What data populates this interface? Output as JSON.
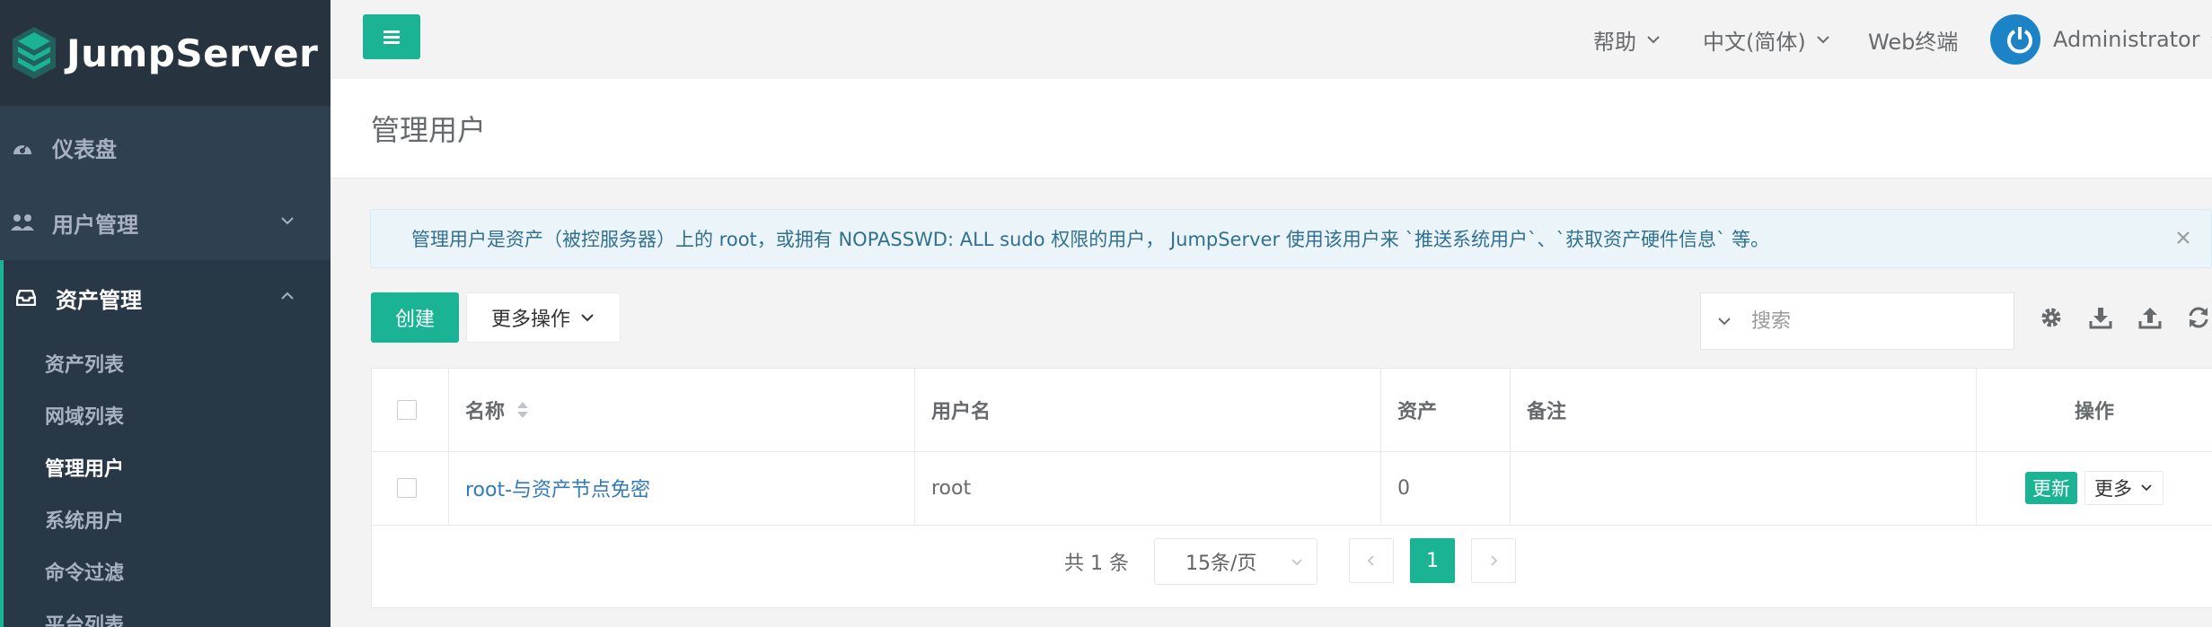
{
  "brand": {
    "name": "JumpServer"
  },
  "sidebar": {
    "items": [
      {
        "label": "仪表盘",
        "icon": "dashboard-icon"
      },
      {
        "label": "用户管理",
        "icon": "users-icon"
      },
      {
        "label": "资产管理",
        "icon": "inbox-icon"
      }
    ],
    "submenu": [
      "资产列表",
      "网域列表",
      "管理用户",
      "系统用户",
      "命令过滤",
      "平台列表"
    ]
  },
  "topbar": {
    "help": "帮助",
    "language": "中文(简体)",
    "web_terminal": "Web终端",
    "user": "Administrator"
  },
  "page": {
    "title": "管理用户"
  },
  "alert": {
    "text": "管理用户是资产（被控服务器）上的 root，或拥有 NOPASSWD: ALL sudo 权限的用户， JumpServer 使用该用户来 `推送系统用户`、`获取资产硬件信息` 等。"
  },
  "toolbar": {
    "create": "创建",
    "more_actions": "更多操作",
    "search_placeholder": "搜索"
  },
  "table": {
    "headers": {
      "name": "名称",
      "username": "用户名",
      "assets": "资产",
      "comment": "备注",
      "actions": "操作"
    },
    "rows": [
      {
        "name": "root-与资产节点免密",
        "username": "root",
        "assets": "0",
        "comment": "",
        "update": "更新",
        "more": "更多"
      }
    ]
  },
  "pagination": {
    "total": "共 1 条",
    "page_size": "15条/页",
    "current": "1"
  },
  "colors": {
    "accent": "#1ab394",
    "sidebar": "#2f4050",
    "link": "#337ab7"
  }
}
